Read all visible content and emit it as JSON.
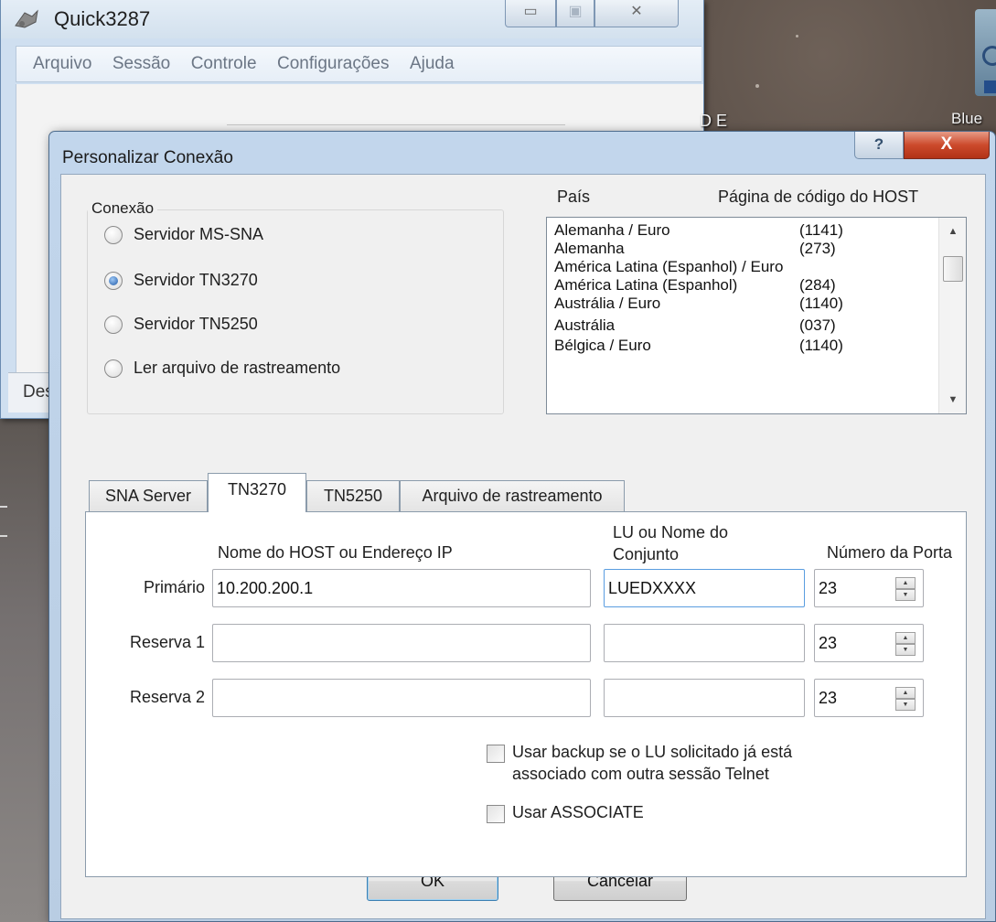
{
  "desktop": {
    "partial_label_left": "D E",
    "partial_label_right": "Blue"
  },
  "background_window": {
    "title": "Quick3287",
    "caption_min": "▭",
    "caption_max": "▣",
    "caption_close": "✕",
    "menu": [
      "Arquivo",
      "Sessão",
      "Controle",
      "Configurações",
      "Ajuda"
    ],
    "status_text": "Des"
  },
  "dialog": {
    "title": "Personalizar Conexão",
    "help_label": "?",
    "close_label": "X",
    "connection_group": {
      "label": "Conexão",
      "options": [
        {
          "label": "Servidor MS-SNA",
          "checked": false
        },
        {
          "label": "Servidor TN3270",
          "checked": true
        },
        {
          "label": "Servidor TN5250",
          "checked": false
        },
        {
          "label": "Ler arquivo de rastreamento",
          "checked": false
        }
      ]
    },
    "country_list": {
      "header_country": "País",
      "header_codepage": "Página de código do HOST",
      "items": [
        {
          "name": "Alemanha / Euro",
          "code": "(1141)"
        },
        {
          "name": "Alemanha",
          "code": "(273)"
        },
        {
          "name": "América Latina (Espanhol) / Euro",
          "code": ""
        },
        {
          "name": "América Latina (Espanhol)",
          "code": "(284)"
        },
        {
          "name": "Austrália / Euro",
          "code": "(1140)"
        },
        {
          "name": "Austrália",
          "code": "(037)"
        },
        {
          "name": "Bélgica / Euro",
          "code": "(1140)"
        }
      ]
    },
    "tabs": [
      {
        "label": "SNA Server",
        "active": false
      },
      {
        "label": "TN3270",
        "active": true
      },
      {
        "label": "TN5250",
        "active": false
      },
      {
        "label": "Arquivo de rastreamento",
        "active": false
      }
    ],
    "tn3270": {
      "col_host": "Nome do HOST ou Endereço IP",
      "col_lu_line1": "LU ou Nome do",
      "col_lu_line2": "Conjunto",
      "col_port": "Número da Porta",
      "rows": [
        {
          "label": "Primário",
          "host": "10.200.200.1",
          "lu": "LUEDXXXX",
          "port": "23"
        },
        {
          "label": "Reserva 1",
          "host": "",
          "lu": "",
          "port": "23"
        },
        {
          "label": "Reserva 2",
          "host": "",
          "lu": "",
          "port": "23"
        }
      ],
      "checkbox_backup_line1": "Usar backup se o LU solicitado já está",
      "checkbox_backup_line2": "associado com outra sessão Telnet",
      "checkbox_associate": "Usar ASSOCIATE"
    },
    "buttons": {
      "ok": "OK",
      "cancel": "Cancelar"
    }
  }
}
